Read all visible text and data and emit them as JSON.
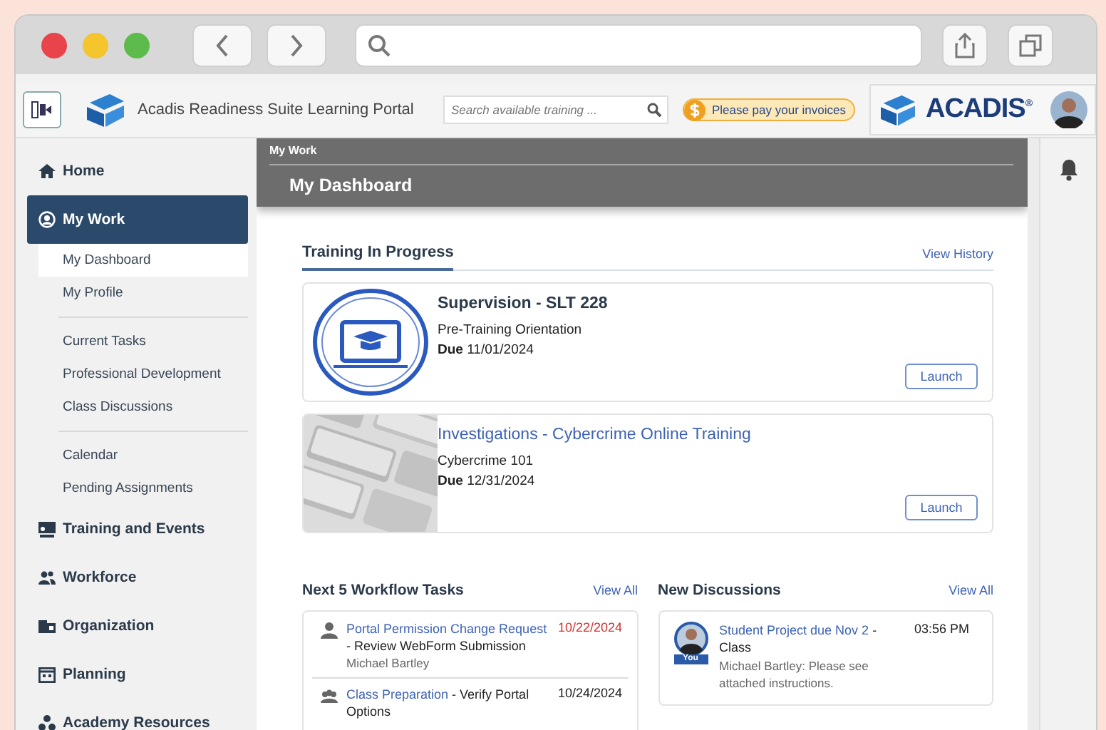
{
  "header": {
    "title": "Acadis Readiness Suite Learning Portal",
    "search": {
      "placeholder": "Search available training ..."
    },
    "notice": "Please pay your invoices",
    "logo_text": "ACADIS$^{®}$"
  },
  "sidebar": {
    "items": [
      {
        "label": "Home",
        "selected": false
      },
      {
        "label": "My Work",
        "selected": true,
        "groups": [
          {
            "items": [
              {
                "label": "My Dashboard",
                "selected": true
              },
              {
                "label": "My Profile",
                "selected": false
              }
            ]
          },
          {
            "items": [
              {
                "label": "Current Tasks",
                "selected": false
              },
              {
                "label": "Professional Development",
                "selected": false
              },
              {
                "label": "Class Discussions",
                "selected": false
              }
            ]
          },
          {
            "items": [
              {
                "label": "Calendar",
                "selected": false
              },
              {
                "label": "Pending Assignments",
                "selected": false
              }
            ]
          }
        ]
      },
      {
        "label": "Training and Events",
        "selected": false
      },
      {
        "label": "Workforce",
        "selected": false
      },
      {
        "label": "Organization",
        "selected": false
      },
      {
        "label": "Planning",
        "selected": false
      },
      {
        "label": "Academy Resources",
        "selected": false
      }
    ]
  },
  "main": {
    "breadcrumb": "My Work",
    "title": "My Dashboard",
    "training": {
      "heading": "Training In Progress",
      "link": "View History",
      "cards": [
        {
          "kind": "icon",
          "title": "Supervision - SLT 228",
          "subtitle": "Pre-Training Orientation",
          "due_label": "Due",
          "due": "11/01/2024",
          "button": "Launch"
        },
        {
          "kind": "picture",
          "title": "Investigations - Cybercrime Online Training",
          "subtitle": "Cybercrime 101",
          "due_label": "Due",
          "due": "12/31/2024",
          "button": "Launch"
        }
      ]
    },
    "tasks": {
      "heading": "Next 5 Workflow Tasks",
      "link": "View All",
      "items": [
        {
          "kind": "person",
          "link": "Portal Permission Change Request",
          "rest": "- Review WebForm Submission",
          "date": "10/22/2024",
          "overdue": true,
          "assignee": "Michael Bartley"
        },
        {
          "kind": "group",
          "link": "Class Preparation",
          "rest": "- Verify Portal Options",
          "date": "10/24/2024",
          "overdue": false
        }
      ]
    },
    "discussions": {
      "heading": "New Discussions",
      "link": "View All",
      "items": [
        {
          "link": "Student Project due Nov 2",
          "rest": "- Class",
          "time": "03:56 PM",
          "badge": "You",
          "message": "Michael Bartley: Please see attached instructions."
        }
      ]
    }
  }
}
